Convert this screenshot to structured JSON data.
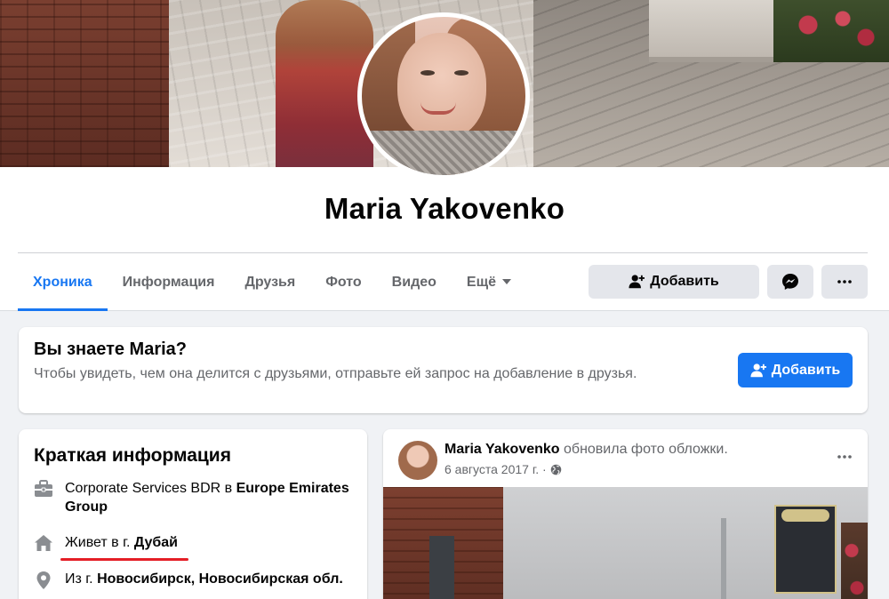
{
  "profile": {
    "name": "Maria Yakovenko"
  },
  "tabs": [
    {
      "label": "Хроника"
    },
    {
      "label": "Информация"
    },
    {
      "label": "Друзья"
    },
    {
      "label": "Фото"
    },
    {
      "label": "Видео"
    },
    {
      "label": "Ещё"
    }
  ],
  "actions": {
    "add_friend": "Добавить",
    "messenger_icon": "messenger-icon",
    "more_icon": "more-dots-icon"
  },
  "know_card": {
    "title": "Вы знаете Maria?",
    "text": "Чтобы увидеть, чем она делится с друзьями, отправьте ей запрос на добавление в друзья.",
    "button": "Добавить"
  },
  "intro": {
    "title": "Краткая информация",
    "work": {
      "prefix": "Corporate Services BDR в ",
      "company": "Europe Emirates Group"
    },
    "lives": {
      "prefix": "Живет в г. ",
      "city": "Дубай"
    },
    "from": {
      "prefix": "Из г. ",
      "place": "Новосибирск, Новосибирская обл."
    }
  },
  "post": {
    "author": "Maria Yakovenko",
    "action": " обновила фото обложки.",
    "date": "6 августа 2017 г. ·",
    "privacy_icon": "globe-icon"
  },
  "colors": {
    "accent": "#1877f2",
    "underline": "#e41e26",
    "background": "#f0f2f5"
  }
}
